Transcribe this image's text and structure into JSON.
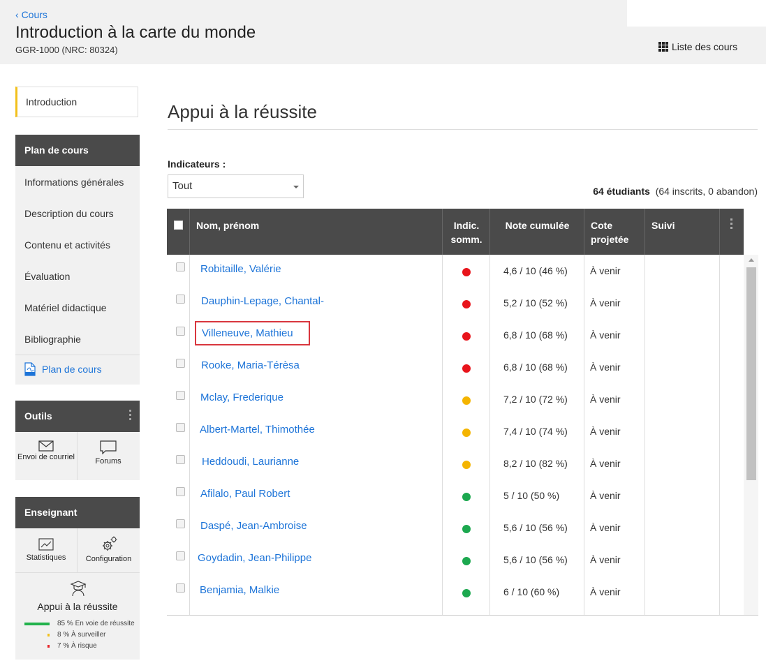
{
  "header": {
    "back_label": "Cours",
    "course_title": "Introduction à la carte du monde",
    "course_code": "GGR-1000 (NRC: 80324)",
    "course_list_label": "Liste des cours"
  },
  "sidebar": {
    "intro_label": "Introduction",
    "plan": {
      "heading": "Plan de cours",
      "items": [
        "Informations générales",
        "Description du cours",
        "Contenu et activités",
        "Évaluation",
        "Matériel didactique",
        "Bibliographie"
      ],
      "pdf_label": "Plan de cours"
    },
    "tools": {
      "heading": "Outils",
      "email_label": "Envoi de courriel",
      "forums_label": "Forums"
    },
    "teacher": {
      "heading": "Enseignant",
      "stats_label": "Statistiques",
      "config_label": "Configuration",
      "success_label": "Appui à la réussite",
      "breakdown": [
        {
          "percent": "85 %",
          "label": "En voie de réussite",
          "value": 85,
          "color": "#22b24c"
        },
        {
          "percent": "8 %",
          "label": "À surveiller",
          "value": 8,
          "color": "#f2c01b"
        },
        {
          "percent": "7 %",
          "label": "À risque",
          "value": 7,
          "color": "#e8262a"
        }
      ]
    }
  },
  "main": {
    "page_title": "Appui à la réussite",
    "indicators_label": "Indicateurs :",
    "indicators_selected": "Tout",
    "students_count": "64 étudiants",
    "students_detail": "(64 inscrits, 0 abandon)",
    "columns": {
      "name": "Nom, prénom",
      "indic_1": "Indic.",
      "indic_2": "somm.",
      "grade": "Note cumulée",
      "cote_1": "Cote",
      "cote_2": "projetée",
      "suivi": "Suivi"
    },
    "rows": [
      {
        "name": "Robitaille, Valérie",
        "status": "red",
        "grade": "4,6 / 10 (46 %)",
        "cote": "À venir"
      },
      {
        "name": "Dauphin-Lepage, Chantal-",
        "status": "red",
        "grade": "5,2 / 10 (52 %)",
        "cote": "À venir"
      },
      {
        "name": "Villeneuve, Mathieu",
        "status": "red",
        "grade": "6,8 / 10 (68 %)",
        "cote": "À venir"
      },
      {
        "name": "Rooke, Maria-Térèsa",
        "status": "red",
        "grade": "6,8 / 10 (68 %)",
        "cote": "À venir"
      },
      {
        "name": "Mclay, Frederique",
        "status": "yellow",
        "grade": "7,2 / 10 (72 %)",
        "cote": "À venir"
      },
      {
        "name": "Albert-Martel, Thimothée",
        "status": "yellow",
        "grade": "7,4 / 10 (74 %)",
        "cote": "À venir"
      },
      {
        "name": "Heddoudi, Laurianne",
        "status": "yellow",
        "grade": "8,2 / 10 (82 %)",
        "cote": "À venir"
      },
      {
        "name": "Afilalo, Paul Robert",
        "status": "green",
        "grade": "5 / 10 (50 %)",
        "cote": "À venir"
      },
      {
        "name": "Daspé, Jean-Ambroise",
        "status": "green",
        "grade": "5,6 / 10 (56 %)",
        "cote": "À venir"
      },
      {
        "name": "Goydadin, Jean-Philippe",
        "status": "green",
        "grade": "5,6 / 10 (56 %)",
        "cote": "À venir"
      },
      {
        "name": "Benjamia, Malkie",
        "status": "green",
        "grade": "6 / 10 (60 %)",
        "cote": "À venir"
      }
    ],
    "status_colors": {
      "red": "#e8141b",
      "yellow": "#f4b400",
      "green": "#1ca84f"
    }
  }
}
